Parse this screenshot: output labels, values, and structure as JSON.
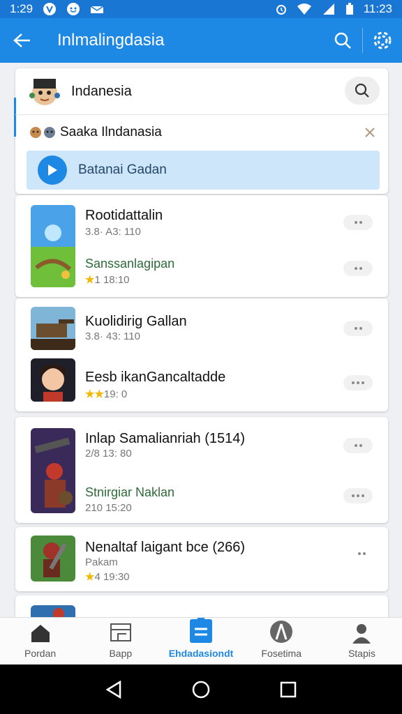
{
  "status_bar": {
    "time_left": "1:29",
    "time_right": "11:23"
  },
  "app_bar": {
    "title": "Inlmalingdasia"
  },
  "header": {
    "country": "Indanesia",
    "filter_text": "Saaka Ilndanasia",
    "banner_text": "Batanai Gadan"
  },
  "apps": [
    {
      "title": "Rootidattalin",
      "meta": "3.8· A3: 110",
      "sub": "Sanssanlagipan",
      "rating": "1 18:10",
      "rating_star": "★"
    },
    {
      "title": "Kuolidirig Gallan",
      "meta": "3.8· 43: 110"
    },
    {
      "title": "Eesb ikanGancaltadde",
      "rating": "19: 0",
      "rating_star": "★★"
    },
    {
      "title": "Inlap Samalianriah (1514)",
      "meta": "2/8 13: 80",
      "sub": "Stnirgiar Naklan",
      "rating_plain": "210 15:20"
    },
    {
      "title": "Nenaltaf laigant bce (266)",
      "meta": "Pakam",
      "rating": "4 19:30",
      "rating_star": "★"
    }
  ],
  "bottom_nav": [
    {
      "label": "Pordan",
      "icon": "home-icon"
    },
    {
      "label": "Bapp",
      "icon": "board-icon"
    },
    {
      "label": "Ehdadasiondt",
      "icon": "list-icon"
    },
    {
      "label": "Fosetima",
      "icon": "compass-icon"
    },
    {
      "label": "Stapis",
      "icon": "person-icon"
    }
  ],
  "colors": {
    "primary": "#1e88e5",
    "status": "#1976d2",
    "banner": "#cde6f9",
    "green_text": "#2e6b3a"
  }
}
